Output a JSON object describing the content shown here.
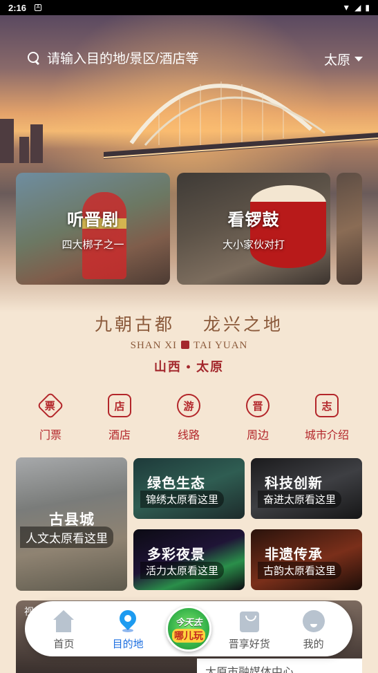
{
  "status_bar": {
    "time": "2:16",
    "notification": "A"
  },
  "search": {
    "placeholder": "请输入目的地/景区/酒店等",
    "city": "太原"
  },
  "cards": [
    {
      "title": "听晋剧",
      "subtitle": "四大梆子之一"
    },
    {
      "title": "看锣鼓",
      "subtitle": "大小家伙对打"
    }
  ],
  "slogan": {
    "cn_left": "九朝古都",
    "cn_right": "龙兴之地",
    "en_left": "SHAN XI",
    "en_right": "TAI YUAN",
    "sub": "山西 • 太原"
  },
  "quick_nav": [
    {
      "glyph": "票",
      "label": "门票",
      "icon": "ticket-icon"
    },
    {
      "glyph": "店",
      "label": "酒店",
      "icon": "hotel-icon"
    },
    {
      "glyph": "游",
      "label": "线路",
      "icon": "route-icon"
    },
    {
      "glyph": "晋",
      "label": "周边",
      "icon": "nearby-icon"
    },
    {
      "glyph": "志",
      "label": "城市介绍",
      "icon": "city-intro-icon"
    }
  ],
  "features": [
    {
      "title": "古县城",
      "subtitle": "人文太原看这里"
    },
    {
      "title": "绿色生态",
      "subtitle": "锦绣太原看这里"
    },
    {
      "title": "科技创新",
      "subtitle": "奋进太原看这里"
    },
    {
      "title": "多彩夜景",
      "subtitle": "活力太原看这里"
    },
    {
      "title": "非遗传承",
      "subtitle": "古韵太原看这里"
    }
  ],
  "video_panel": {
    "tag": "视",
    "source": "太原市融媒体中心"
  },
  "tabbar": {
    "items": [
      {
        "label": "首页",
        "icon": "home-icon"
      },
      {
        "label": "目的地",
        "icon": "location-pin-icon"
      },
      {
        "label": "晋享好货",
        "icon": "shopping-bag-icon"
      },
      {
        "label": "我的",
        "icon": "profile-icon"
      }
    ],
    "center": {
      "line1": "今天去",
      "line2": "哪儿玩"
    },
    "active_color": "#1d6fe0",
    "inactive_color": "#555555"
  },
  "colors": {
    "accent_red": "#b3262a",
    "slogan_brown": "#8b5a3b",
    "background": "#f5e6d3"
  }
}
